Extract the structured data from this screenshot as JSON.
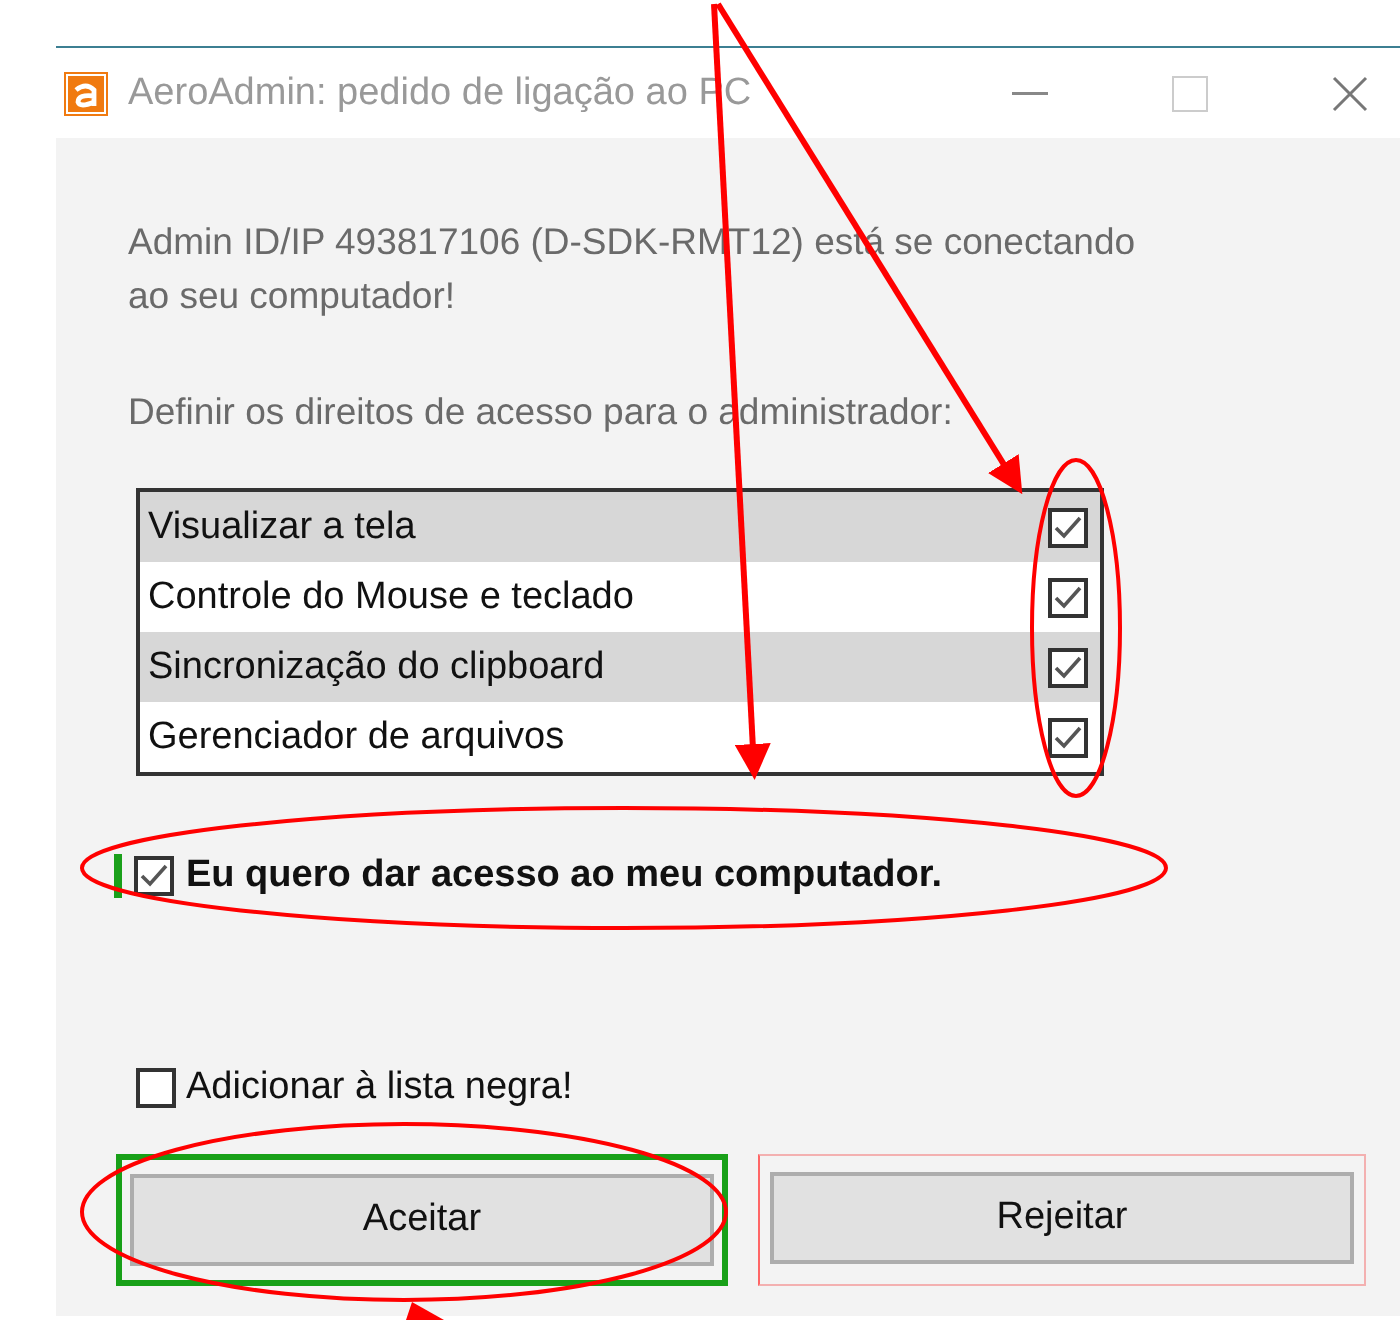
{
  "window": {
    "title": "AeroAdmin: pedido de ligação ao PC"
  },
  "message": "Admin ID/IP 493817106 (D-SDK-RMT12)  está se conectando ao seu computador!",
  "prompt": "Definir os direitos de acesso para o administrador:",
  "permissions": [
    {
      "label": "Visualizar a tela",
      "checked": true
    },
    {
      "label": "Controle do Mouse e teclado",
      "checked": true
    },
    {
      "label": "Sincronização do clipboard",
      "checked": true
    },
    {
      "label": "Gerenciador de arquivos",
      "checked": true
    }
  ],
  "consent": {
    "label": "Eu quero dar acesso ao meu computador.",
    "checked": true
  },
  "blacklist": {
    "label": "Adicionar à lista negra!",
    "checked": false
  },
  "buttons": [
    {
      "label": "Aceitar",
      "focused": true
    },
    {
      "label": "Rejeitar",
      "focused": false
    }
  ]
}
